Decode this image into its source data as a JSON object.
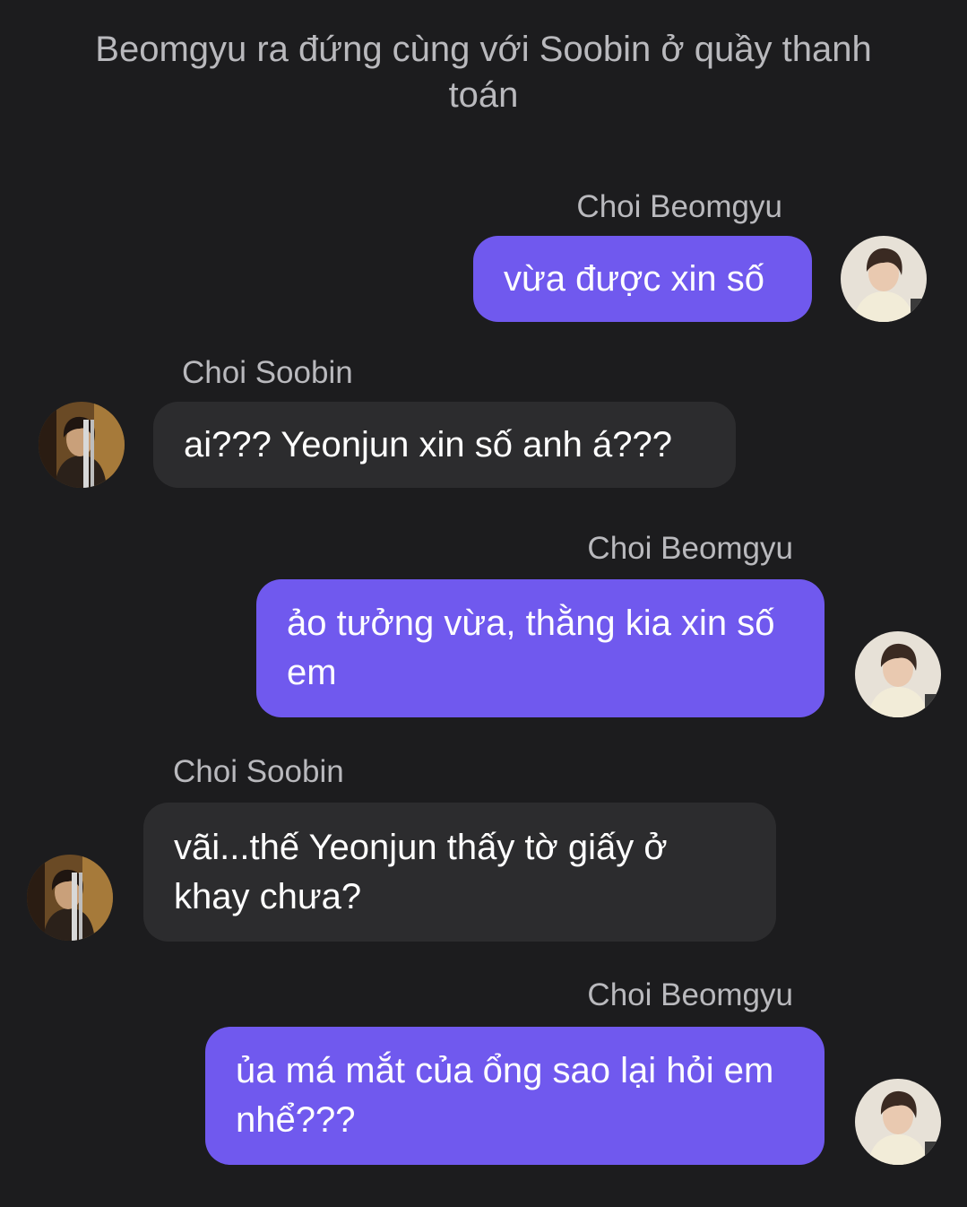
{
  "narration": "Beomgyu ra đứng cùng với Soobin ở quầy thanh toán",
  "messages": [
    {
      "sender": "Choi Beomgyu",
      "text": "vừa được xin số",
      "direction": "outgoing",
      "avatar": "beomgyu-avatar"
    },
    {
      "sender": "Choi Soobin",
      "text": "ai??? Yeonjun xin số anh á???",
      "direction": "incoming",
      "avatar": "soobin-avatar"
    },
    {
      "sender": "Choi Beomgyu",
      "text": "ảo tưởng vừa, thằng kia xin số em",
      "direction": "outgoing",
      "avatar": "beomgyu-avatar"
    },
    {
      "sender": "Choi Soobin",
      "text": "vãi...thế Yeonjun thấy tờ giấy ở khay chưa?",
      "direction": "incoming",
      "avatar": "soobin-avatar"
    },
    {
      "sender": "Choi Beomgyu",
      "text": "ủa má mắt của ổng sao lại hỏi em nhể???",
      "direction": "outgoing",
      "avatar": "beomgyu-avatar"
    }
  ],
  "colors": {
    "background": "#1c1c1e",
    "outgoing_bubble": "#7059ee",
    "incoming_bubble": "#2c2c2e",
    "meta_text": "#b9b9bd"
  }
}
